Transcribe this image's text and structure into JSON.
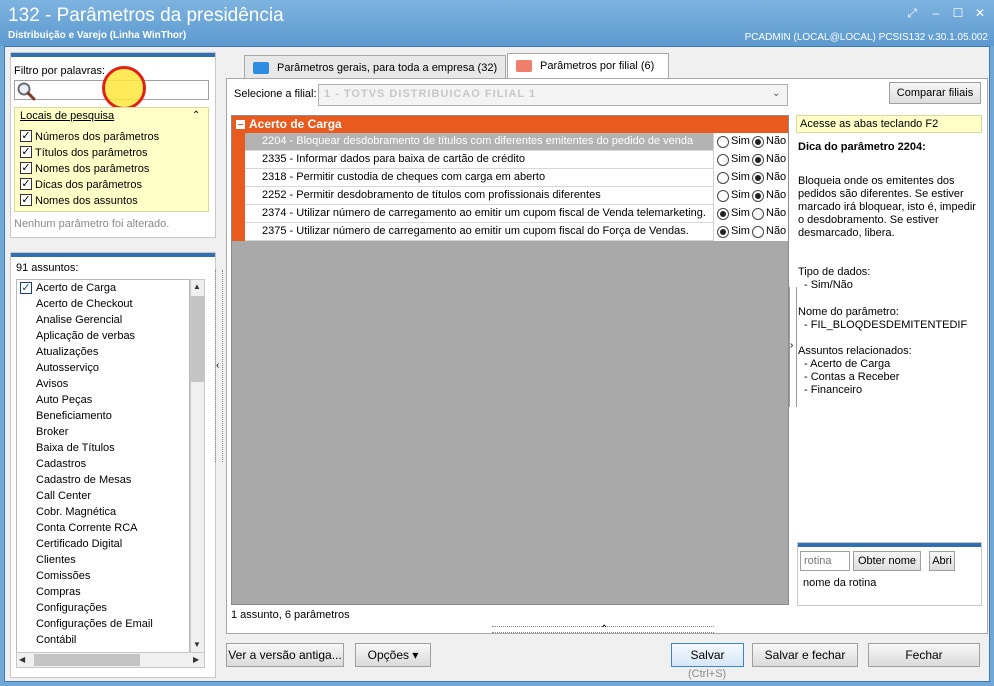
{
  "window": {
    "title": "132 - Parâmetros da presidência",
    "subtitle": "Distribuição e Varejo (Linha WinThor)",
    "connection": "PCADMIN (LOCAL@LOCAL)   PCSIS132  v.30.1.05.002"
  },
  "filter": {
    "label": "Filtro por palavras:",
    "placeholder": "",
    "value": "",
    "search_title": "Locais de pesquisa",
    "options": [
      {
        "label": "Números dos parâmetros",
        "checked": true
      },
      {
        "label": "Títulos dos parâmetros",
        "checked": true
      },
      {
        "label": "Nomes dos parâmetros",
        "checked": true
      },
      {
        "label": "Dicas dos parâmetros",
        "checked": true
      },
      {
        "label": "Nomes dos assuntos",
        "checked": true
      }
    ],
    "status": "Nenhum parâmetro foi alterado."
  },
  "subjects": {
    "count_label": "91 assuntos:",
    "items": [
      "Acerto de Carga",
      "Acerto de Checkout",
      "Analise Gerencial",
      "Aplicação de verbas",
      "Atualizações",
      "Autosserviço",
      "Avisos",
      "Auto Peças",
      "Beneficiamento",
      "Broker",
      "Baixa de Títulos",
      "Cadastros",
      "Cadastro de Mesas",
      "Call Center",
      "Cobr. Magnética",
      "Conta Corrente RCA",
      "Certificado Digital",
      "Clientes",
      "Comissões",
      "Compras",
      "Configurações",
      "Configurações de Email",
      "Contábil"
    ]
  },
  "tabs": [
    {
      "label": "Parâmetros gerais, para toda a empresa  (32)"
    },
    {
      "label": "Parâmetros por filial  (6)"
    }
  ],
  "branch": {
    "label": "Selecione a filial:",
    "value": "1 - TOTVS DISTRIBUICAO FILIAL 1",
    "compare_label": "Comparar filiais"
  },
  "params": {
    "group": "Acerto de Carga",
    "rows": [
      {
        "label": "2204 - Bloquear desdobramento de títulos com diferentes emitentes do pedido de venda",
        "value": "Não",
        "selected": true
      },
      {
        "label": "2335 - Informar dados para baixa de cartão de crédito",
        "value": "Não"
      },
      {
        "label": "2318 - Permitir custodia de cheques com carga em aberto",
        "value": "Não"
      },
      {
        "label": "2252 - Permitir desdobramento de títulos com profissionais diferentes",
        "value": "Não"
      },
      {
        "label": "2374 - Utilizar número de carregamento ao emitir um cupom fiscal de Venda telemarketing.",
        "value": "Sim"
      },
      {
        "label": "2375 - Utilizar número de carregamento ao emitir um cupom fiscal do Força de Vendas.",
        "value": "Sim"
      }
    ],
    "yes_label": "Sim",
    "no_label": "Não",
    "footer": "1 assunto, 6 parâmetros"
  },
  "help": {
    "hint": "Acesse as abas teclando F2",
    "title": "Dica do parâmetro 2204:",
    "text": "Bloqueia onde os emitentes dos pedidos são diferentes. Se estiver marcado irá bloquear, isto é, impedir o desdobramento. Se estiver desmarcado, libera.",
    "type_label": "Tipo de dados:",
    "type_value": "- Sim/Não",
    "name_label": "Nome do parâmetro:",
    "name_value": "- FIL_BLOQDESDEMITENTEDIF",
    "related_label": "Assuntos relacionados:",
    "related": [
      "- Acerto de Carga",
      "- Contas a Receber",
      "- Financeiro"
    ]
  },
  "routine": {
    "placeholder": "rotina",
    "get_name_label": "Obter nome",
    "open_label": "Abri",
    "name_label": "nome da rotina"
  },
  "footer": {
    "old_version_label": "Ver a versão antiga...",
    "options_label": "Opções ▾",
    "save_label": "Salvar",
    "save_shortcut": "(Ctrl+S)",
    "save_close_label": "Salvar e fechar",
    "close_label": "Fechar"
  },
  "colors": {
    "accent": "#2f6fb4",
    "group_header": "#e85a1e",
    "hint_bg": "#ffffc8"
  }
}
